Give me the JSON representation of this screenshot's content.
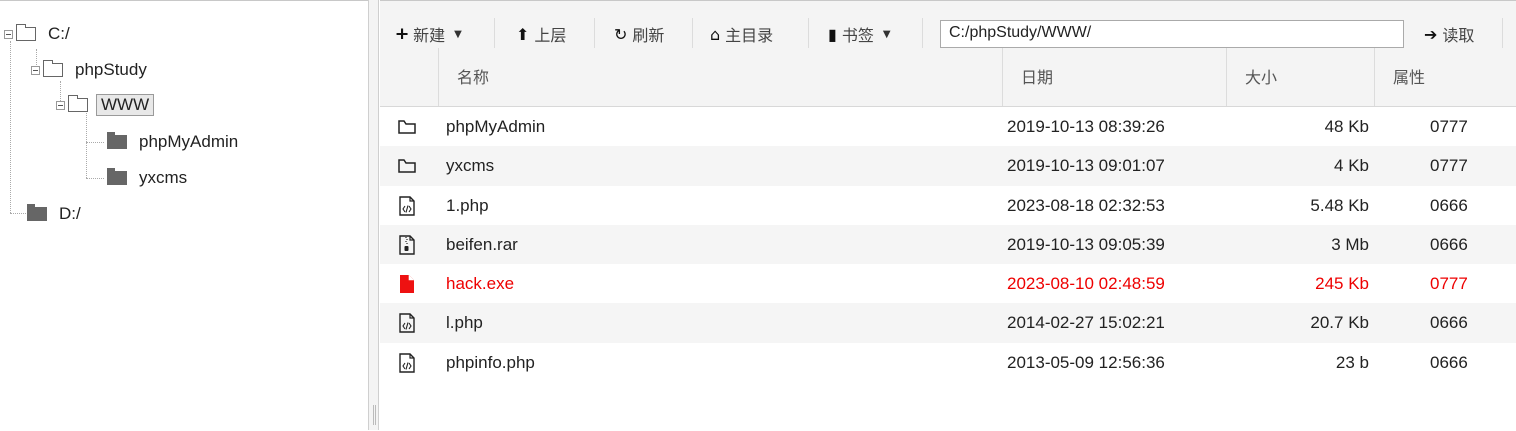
{
  "tree": {
    "root_c": "C:/",
    "phpstudy": "phpStudy",
    "www": "WWW",
    "phpmyadmin": "phpMyAdmin",
    "yxcms": "yxcms",
    "root_d": "D:/"
  },
  "toolbar": {
    "new_label": "新建",
    "up_label": "上层",
    "refresh_label": "刷新",
    "home_label": "主目录",
    "bookmark_label": "书签",
    "path_value": "C:/phpStudy/WWW/",
    "read_label": "读取"
  },
  "table": {
    "headers": {
      "name": "名称",
      "date": "日期",
      "size": "大小",
      "attr": "属性"
    },
    "rows": [
      {
        "icon": "folder-icon",
        "name": "phpMyAdmin",
        "date": "2019-10-13 08:39:26",
        "size": "48 Kb",
        "attr": "0777"
      },
      {
        "icon": "folder-icon",
        "name": "yxcms",
        "date": "2019-10-13 09:01:07",
        "size": "4 Kb",
        "attr": "0777"
      },
      {
        "icon": "code-file-icon",
        "name": "1.php",
        "date": "2023-08-18 02:32:53",
        "size": "5.48 Kb",
        "attr": "0666"
      },
      {
        "icon": "archive-file-icon",
        "name": "beifen.rar",
        "date": "2019-10-13 09:05:39",
        "size": "3 Mb",
        "attr": "0666"
      },
      {
        "icon": "red-file-icon",
        "name": "hack.exe",
        "date": "2023-08-10 02:48:59",
        "size": "245 Kb",
        "attr": "0777",
        "highlight_color": "#ee0000"
      },
      {
        "icon": "code-file-icon",
        "name": "l.php",
        "date": "2014-02-27 15:02:21",
        "size": "20.7 Kb",
        "attr": "0666"
      },
      {
        "icon": "code-file-icon",
        "name": "phpinfo.php",
        "date": "2013-05-09 12:56:36",
        "size": "23 b",
        "attr": "0666"
      }
    ]
  }
}
